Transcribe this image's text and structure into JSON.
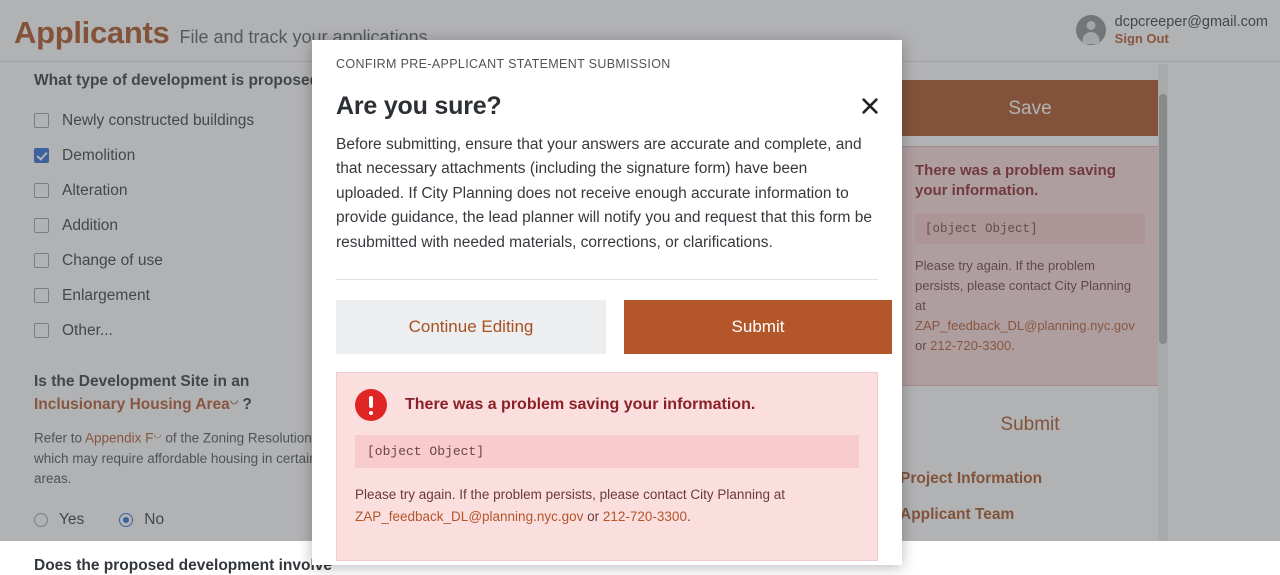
{
  "header": {
    "brand_title": "Applicants",
    "brand_subtitle": "File and track your applications",
    "account_email": "dcpcreeper@gmail.com",
    "sign_out_label": "Sign Out",
    "avatar_icon": "user-avatar-icon"
  },
  "form": {
    "development_type_question": "What type of development is proposed?",
    "development_type_options": [
      {
        "label": "Newly constructed buildings",
        "checked": false
      },
      {
        "label": "Demolition",
        "checked": true
      },
      {
        "label": "Alteration",
        "checked": false
      },
      {
        "label": "Addition",
        "checked": false
      },
      {
        "label": "Change of use",
        "checked": false
      },
      {
        "label": "Enlargement",
        "checked": false
      },
      {
        "label": "Other...",
        "checked": false
      }
    ],
    "inclusionary": {
      "question_prefix": "Is the Development Site in an ",
      "question_link": "Inclusionary Housing Area",
      "question_suffix": " ?",
      "help_prefix": "Refer to ",
      "help_link": "Appendix F",
      "help_suffix": " of the Zoning Resolution, which may require affordable housing in certain areas.",
      "external_link_icon": "external-link-icon",
      "options": [
        {
          "label": "Yes",
          "selected": false
        },
        {
          "label": "No",
          "selected": true
        }
      ]
    },
    "next_question": "Does the proposed development involve"
  },
  "sidebar": {
    "save_label": "Save",
    "submit_label": "Submit",
    "alert": {
      "title": "There was a problem saving your information.",
      "code": "[object Object]",
      "note_prefix": "Please try again. If the problem persists, please contact City Planning at ",
      "note_email": "ZAP_feedback_DL@planning.nyc.gov",
      "note_middle": " or ",
      "note_phone": "212-720-3300",
      "note_suffix": "."
    },
    "nav_links": [
      "Project Information",
      "Applicant Team"
    ]
  },
  "modal": {
    "kicker": "CONFIRM PRE-APPLICANT STATEMENT SUBMISSION",
    "close_icon": "close-icon",
    "title": "Are you sure?",
    "body": "Before submitting, ensure that your answers are accurate and complete, and that necessary attachments (including the signature form) have been uploaded. If City Planning does not receive enough accurate information to provide guidance, the lead planner will notify you and request that this form be resubmitted with needed materials, corrections, or clarifications.",
    "continue_label": "Continue Editing",
    "submit_label": "Submit",
    "alert": {
      "icon": "error-exclamation-icon",
      "title": "There was a problem saving your information.",
      "code": "[object Object]",
      "note_prefix": "Please try again. If the problem persists, please contact City Planning at ",
      "note_email": "ZAP_feedback_DL@planning.nyc.gov",
      "note_middle": " or ",
      "note_phone": "212-720-3300",
      "note_suffix": "."
    }
  },
  "colors": {
    "brand": "#a9501f",
    "accent": "#b3562a",
    "error": "#e02525",
    "error_bg": "#fbdede",
    "checkbox_blue": "#2b6cd4"
  }
}
